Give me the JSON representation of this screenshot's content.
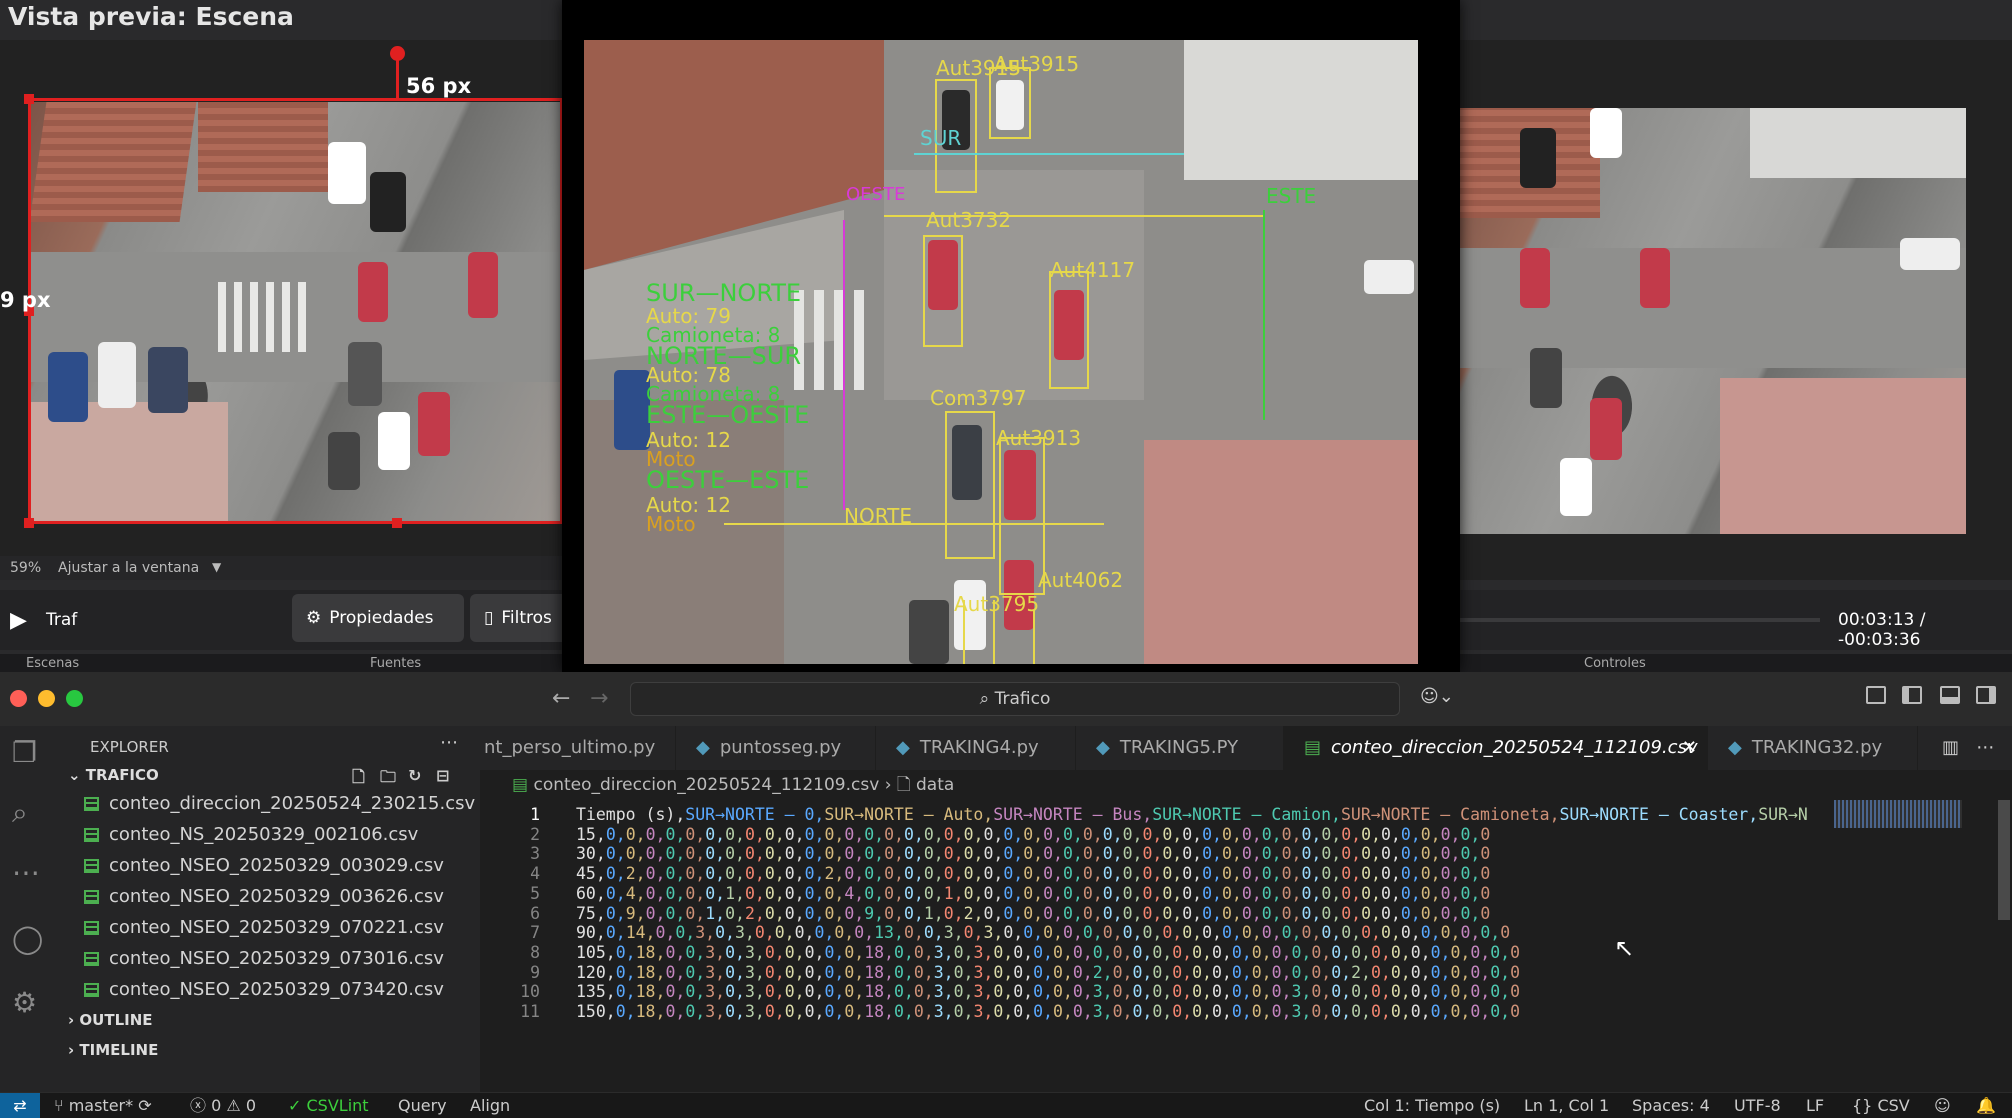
{
  "editor": {
    "preview_title": "Vista previa: Escena",
    "crop_top_label": "56 px",
    "crop_left_label": "9 px",
    "zoom_percent": "59%",
    "zoom_fit_label": "Ajustar a la ventana",
    "clip_name": "Traf",
    "properties_label": "Propiedades",
    "filters_label": "Filtros",
    "timecode": "00:03:13  /  -00:03:36",
    "strip_tabs": [
      "Escenas",
      "Fuentes",
      "Controles"
    ]
  },
  "video_overlay": {
    "vehicle_labels": [
      "Aut3915",
      "Aut3915",
      "Aut3732",
      "Aut4117",
      "Com3797",
      "Aut3913",
      "Aut4062",
      "Aut3795"
    ],
    "line_labels": [
      "SUR",
      "OESTE",
      "ESTE",
      "NORTE"
    ],
    "counts": [
      {
        "heading": "SUR—NORTE",
        "lines": [
          "Auto: 79",
          "Camioneta: 8"
        ]
      },
      {
        "heading": "NORTE—SUR",
        "lines": [
          "Auto: 78",
          "Camioneta: 8"
        ]
      },
      {
        "heading": "ESTE—OESTE",
        "lines": [
          "Auto: 12",
          "Moto"
        ]
      },
      {
        "heading": "OESTE—ESTE",
        "lines": [
          "Auto: 12",
          "Moto"
        ]
      }
    ]
  },
  "vscode": {
    "search": "Trafico",
    "explorer_title": "EXPLORER",
    "folder": "TRAFICO",
    "files": [
      "conteo_direccion_20250524_230215.csv",
      "conteo_NS_20250329_002106.csv",
      "conteo_NSEO_20250329_003029.csv",
      "conteo_NSEO_20250329_003626.csv",
      "conteo_NSEO_20250329_070221.csv",
      "conteo_NSEO_20250329_073016.csv",
      "conteo_NSEO_20250329_073420.csv"
    ],
    "outline": "OUTLINE",
    "timeline": "TIMELINE",
    "tabs": [
      "nt_perso_ultimo.py",
      "puntosseg.py",
      "TRAKING4.py",
      "TRAKING5.PY",
      "conteo_direccion_20250524_112109.csv",
      "TRAKING32.py"
    ],
    "active_tab": 4,
    "breadcrumb_file": "conteo_direccion_20250524_112109.csv",
    "breadcrumb_data": "data",
    "lines": [
      "Tiempo (s),SUR→NORTE – 0,SUR→NORTE – Auto,SUR→NORTE – Bus,SUR→NORTE – Camion,SUR→NORTE – Camioneta,SUR→NORTE – Coaster,SUR→N",
      "15,0,0,0,0,0,0,0,0,0,0,0,0,0,0,0,0,0,0,0,0,0,0,0,0,0,0,0,0,0,0,0,0,0,0,0,0,0,0,0,0,0,0,0,0,0",
      "30,0,0,0,0,0,0,0,0,0,0,0,0,0,0,0,0,0,0,0,0,0,0,0,0,0,0,0,0,0,0,0,0,0,0,0,0,0,0,0,0,0,0,0,0,0",
      "45,0,2,0,0,0,0,0,0,0,0,0,2,0,0,0,0,0,0,0,0,0,0,0,0,0,0,0,0,0,0,0,0,0,0,0,0,0,0,0,0,0,0,0,0,0",
      "60,0,4,0,0,0,0,1,0,0,0,0,0,4,0,0,0,0,1,0,0,0,0,0,0,0,0,0,0,0,0,0,0,0,0,0,0,0,0,0,0,0,0,0,0,0",
      "75,0,9,0,0,0,1,0,2,0,0,0,0,0,9,0,0,1,0,2,0,0,0,0,0,0,0,0,0,0,0,0,0,0,0,0,0,0,0,0,0,0,0,0,0,0",
      "90,0,14,0,0,3,0,3,0,0,0,0,0,0,13,0,0,3,0,3,0,0,0,0,0,0,0,0,0,0,0,0,0,0,0,0,0,0,0,0,0,0,0,0,0,0",
      "105,0,18,0,0,3,0,3,0,0,0,0,0,18,0,0,3,0,3,0,0,0,0,0,0,0,0,0,0,0,0,0,0,0,0,0,0,0,0,0,0,0,0,0,0,0",
      "120,0,18,0,0,3,0,3,0,0,0,0,0,18,0,0,3,0,3,0,0,0,0,0,2,0,0,0,0,0,0,0,0,0,0,0,0,2,0,0,0,0,0,0,0,0",
      "135,0,18,0,0,3,0,3,0,0,0,0,0,18,0,0,3,0,3,0,0,0,0,0,3,0,0,0,0,0,0,0,0,0,3,0,0,0,0,0,0,0,0,0,0,0",
      "150,0,18,0,0,3,0,3,0,0,0,0,0,18,0,0,3,0,3,0,0,0,0,0,3,0,0,0,0,0,0,0,0,0,3,0,0,0,0,0,0,0,0,0,0,0"
    ],
    "status": {
      "branch": "master*",
      "errors": "0",
      "warnings": "0",
      "csvlint": "CSVLint",
      "query": "Query",
      "align": "Align",
      "col": "Col 1: Tiempo (s)",
      "position": "Ln 1, Col 1",
      "spaces": "Spaces: 4",
      "encoding": "UTF-8",
      "eol": "LF",
      "language": "CSV"
    }
  },
  "colors": {
    "label_yellow": "#e6d84a",
    "label_green": "#3ccf3c",
    "crop_red": "#e02020",
    "csv_icon": "#4caf50",
    "py_icon": "#519aba",
    "status_remote": "#0e639c"
  }
}
